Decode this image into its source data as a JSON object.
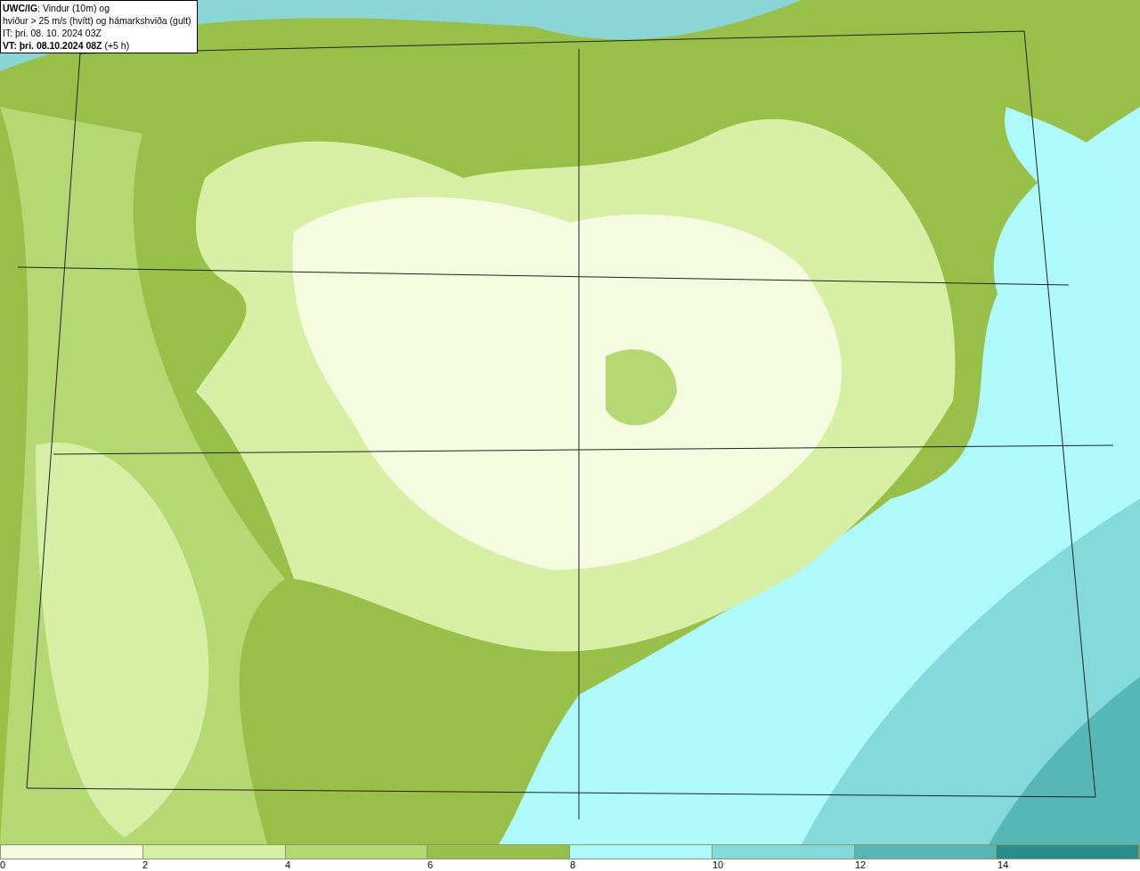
{
  "legend": {
    "lines": [
      "**UWC/IG**: Vindur (10m) og",
      "hviður > 25 m/s (hvítt) og hámarkshviða (gult)",
      "IT: þri. 08. 10. 2024 03Z",
      "**VT: þri. 08.10.2024 08Z** (+5 h)"
    ]
  },
  "colorbar": [
    {
      "color": "#f4fbdf",
      "label": "0"
    },
    {
      "color": "#d6efa4",
      "label": "2"
    },
    {
      "color": "#b4d872",
      "label": "4"
    },
    {
      "color": "#98bf47",
      "label": "6"
    },
    {
      "color": "#adfafa",
      "label": "8"
    },
    {
      "color": "#84dada",
      "label": "10"
    },
    {
      "color": "#57b7b7",
      "label": "12"
    },
    {
      "color": "#268f8c",
      "label": "14"
    }
  ]
}
